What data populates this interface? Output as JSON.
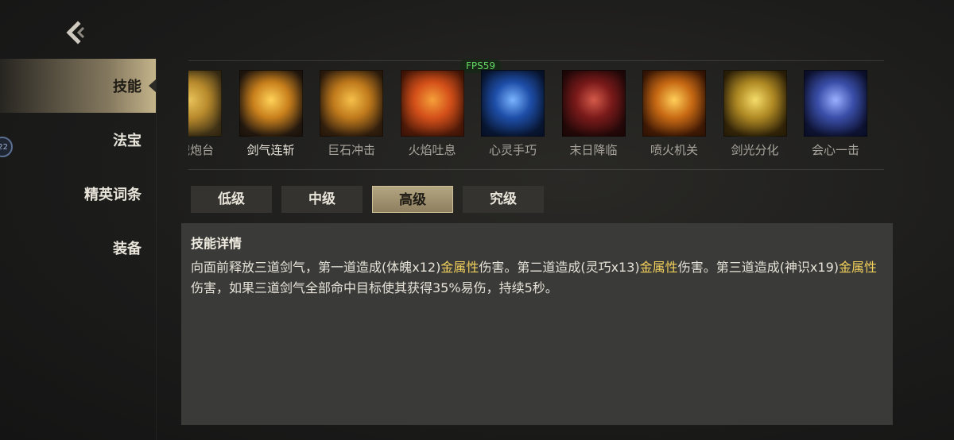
{
  "nav": {
    "items": [
      {
        "label": "技能",
        "active": true
      },
      {
        "label": "法宝",
        "active": false
      },
      {
        "label": "精英词条",
        "active": false
      },
      {
        "label": "装备",
        "active": false
      }
    ],
    "badge": "22"
  },
  "fps_label": "FPS59",
  "skills": [
    {
      "name": "机械炮台",
      "icon": "turret-icon",
      "colors": [
        "#4a3a1a",
        "#b88a2c",
        "#e8c25a"
      ]
    },
    {
      "name": "剑气连斩",
      "icon": "sword-energy-icon",
      "colors": [
        "#2a1d12",
        "#c9801c",
        "#ffd25a"
      ],
      "selected": true
    },
    {
      "name": "巨石冲击",
      "icon": "boulder-icon",
      "colors": [
        "#3a2410",
        "#c07a1c",
        "#f5c04a"
      ]
    },
    {
      "name": "火焰吐息",
      "icon": "flame-breath-icon",
      "colors": [
        "#5a1e0a",
        "#d4501a",
        "#f5a03a"
      ]
    },
    {
      "name": "心灵手巧",
      "icon": "dexterity-icon",
      "colors": [
        "#0a1a3a",
        "#1e4ea8",
        "#7ab4ff"
      ]
    },
    {
      "name": "末日降临",
      "icon": "doomsday-icon",
      "colors": [
        "#2a0a0a",
        "#7a1a1a",
        "#d45a4a"
      ]
    },
    {
      "name": "喷火机关",
      "icon": "flamethrower-icon",
      "colors": [
        "#4a1e06",
        "#c86a14",
        "#ffcf5a"
      ]
    },
    {
      "name": "剑光分化",
      "icon": "sword-light-icon",
      "colors": [
        "#3a2a0a",
        "#b08a24",
        "#f5dc6a"
      ]
    },
    {
      "name": "会心一击",
      "icon": "critical-strike-icon",
      "colors": [
        "#10163a",
        "#3a4ea8",
        "#9ab0ff"
      ]
    }
  ],
  "tabs": [
    {
      "label": "低级",
      "active": false
    },
    {
      "label": "中级",
      "active": false
    },
    {
      "label": "高级",
      "active": true
    },
    {
      "label": "究级",
      "active": false
    }
  ],
  "detail": {
    "title": "技能详情",
    "segments": [
      {
        "text": "向面前释放三道剑气，第一道造成(体魄x12)",
        "gold": false
      },
      {
        "text": "金属性",
        "gold": true
      },
      {
        "text": "伤害。第二道造成(灵巧x13)",
        "gold": false
      },
      {
        "text": "金属性",
        "gold": true
      },
      {
        "text": "伤害。第三道造成(神识x19)",
        "gold": false
      },
      {
        "text": "金属性",
        "gold": true
      },
      {
        "text": "伤害，如果三道剑气全部命中目标使其获得35%易伤，持续5秒。",
        "gold": false
      }
    ]
  },
  "colors": {
    "accent_gold": "#f2d05c",
    "active_tab": "#b5a682",
    "panel": "#3a3a38"
  }
}
